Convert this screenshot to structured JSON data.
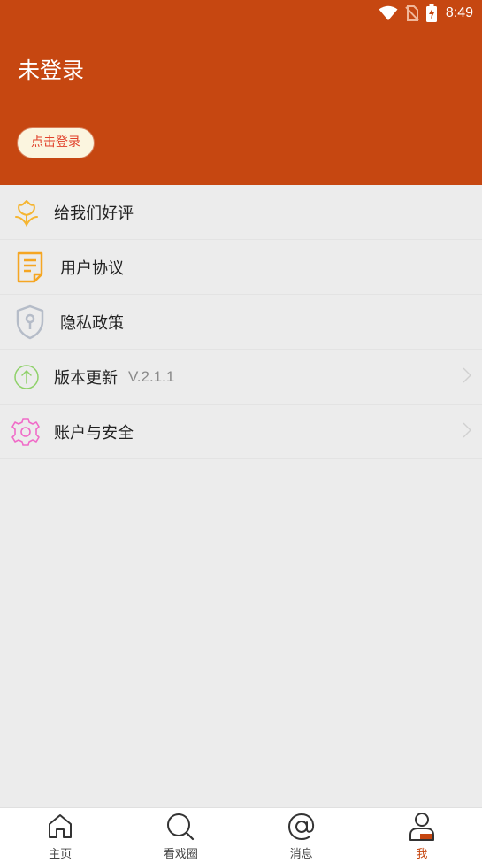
{
  "status_bar": {
    "time": "8:49",
    "icons": [
      "wifi-icon",
      "no-sim-icon",
      "battery-charging-icon"
    ]
  },
  "header": {
    "user_name": "未登录",
    "login_button": "点击登录",
    "background_color": "#c64711"
  },
  "menu": {
    "items": [
      {
        "label": "给我们好评",
        "icon": "flower-icon"
      },
      {
        "label": "用户协议",
        "icon": "document-icon"
      },
      {
        "label": "隐私政策",
        "icon": "shield-lock-icon"
      },
      {
        "label": "版本更新",
        "value": "V.2.1.1",
        "icon": "upload-arrow-icon",
        "has_chevron": true
      },
      {
        "label": "账户与安全",
        "icon": "gear-icon",
        "has_chevron": true
      }
    ]
  },
  "tabbar": {
    "tabs": [
      {
        "label": "主页",
        "icon": "home-icon"
      },
      {
        "label": "看戏圈",
        "icon": "search-icon"
      },
      {
        "label": "消息",
        "icon": "at-icon"
      },
      {
        "label": "我",
        "icon": "profile-icon",
        "active": true
      }
    ],
    "active_color": "#c64711"
  }
}
